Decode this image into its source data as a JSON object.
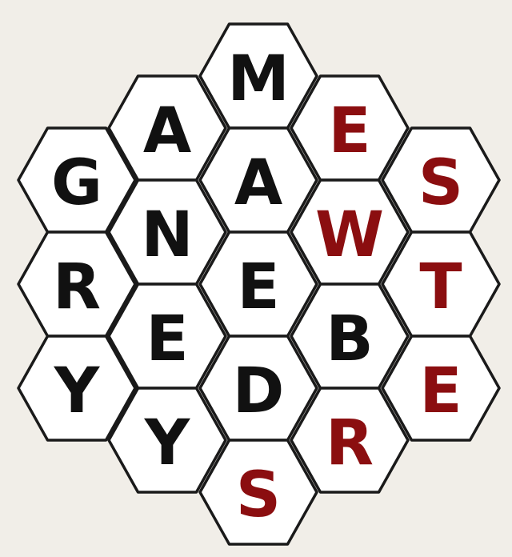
{
  "colors": {
    "background": "#f1eee8",
    "hex_fill": "#ffffff",
    "hex_stroke": "#1a1a1a",
    "letter_default": "#111111",
    "letter_highlight": "#8b0e10"
  },
  "puzzle": {
    "columns": [
      {
        "cells": [
          {
            "letter": "G",
            "highlight": false
          },
          {
            "letter": "R",
            "highlight": false
          },
          {
            "letter": "Y",
            "highlight": false
          }
        ]
      },
      {
        "cells": [
          {
            "letter": "A",
            "highlight": false
          },
          {
            "letter": "N",
            "highlight": false
          },
          {
            "letter": "E",
            "highlight": false
          },
          {
            "letter": "Y",
            "highlight": false
          }
        ]
      },
      {
        "cells": [
          {
            "letter": "M",
            "highlight": false
          },
          {
            "letter": "A",
            "highlight": false
          },
          {
            "letter": "E",
            "highlight": false
          },
          {
            "letter": "D",
            "highlight": false
          },
          {
            "letter": "S",
            "highlight": true
          }
        ]
      },
      {
        "cells": [
          {
            "letter": "E",
            "highlight": true
          },
          {
            "letter": "W",
            "highlight": true
          },
          {
            "letter": "B",
            "highlight": false
          },
          {
            "letter": "R",
            "highlight": true
          }
        ]
      },
      {
        "cells": [
          {
            "letter": "S",
            "highlight": true
          },
          {
            "letter": "T",
            "highlight": true
          },
          {
            "letter": "E",
            "highlight": true
          }
        ]
      }
    ]
  }
}
